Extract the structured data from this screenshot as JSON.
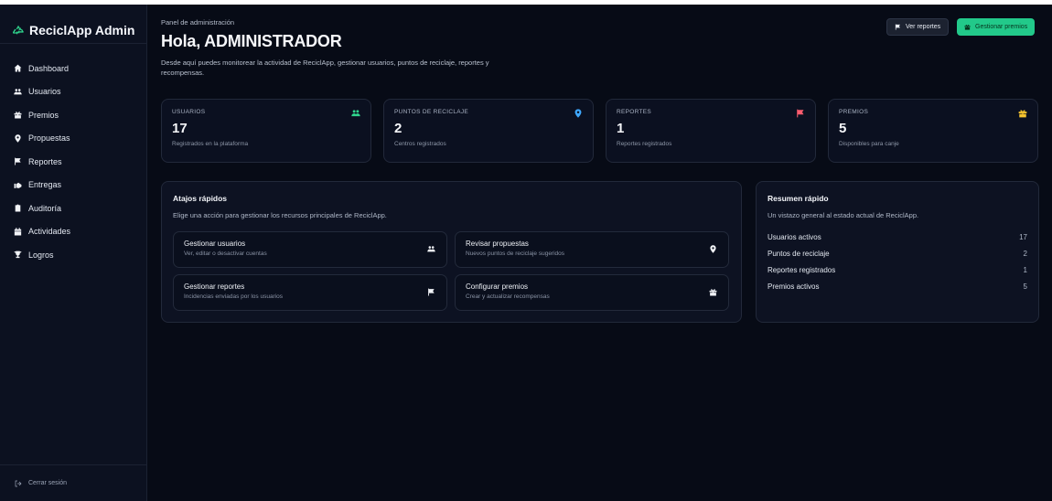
{
  "brand": {
    "name": "ReciclApp Admin",
    "icon": "recycle-icon"
  },
  "nav": [
    {
      "label": "Dashboard",
      "icon": "home-icon"
    },
    {
      "label": "Usuarios",
      "icon": "users-icon"
    },
    {
      "label": "Premios",
      "icon": "gift-icon"
    },
    {
      "label": "Propuestas",
      "icon": "map-pin-icon"
    },
    {
      "label": "Reportes",
      "icon": "flag-icon"
    },
    {
      "label": "Entregas",
      "icon": "handshake-icon"
    },
    {
      "label": "Auditoría",
      "icon": "clipboard-icon"
    },
    {
      "label": "Actividades",
      "icon": "calendar-icon"
    },
    {
      "label": "Logros",
      "icon": "trophy-icon"
    }
  ],
  "logout": {
    "label": "Cerrar sesión",
    "icon": "logout-icon"
  },
  "header": {
    "eyebrow": "Panel de administración",
    "title": "Hola, ADMINISTRADOR",
    "intro": "Desde aquí puedes monitorear la actividad de ReciclApp, gestionar usuarios, puntos de reciclaje, reportes y recompensas.",
    "btn_reports": "Ver reportes",
    "btn_prizes": "Gestionar premios"
  },
  "colors": {
    "accent_green": "#22c98a",
    "users_icon": "#2fd38c",
    "pin_icon": "#3fa8ff",
    "flag_icon": "#ff5c6e",
    "gift_icon": "#f6c32e"
  },
  "stats": [
    {
      "label": "USUARIOS",
      "value": "17",
      "sub": "Registrados en la plataforma",
      "icon": "users-icon"
    },
    {
      "label": "PUNTOS DE RECICLAJE",
      "value": "2",
      "sub": "Centros registrados",
      "icon": "map-pin-icon"
    },
    {
      "label": "REPORTES",
      "value": "1",
      "sub": "Reportes registrados",
      "icon": "flag-icon"
    },
    {
      "label": "PREMIOS",
      "value": "5",
      "sub": "Disponibles para canje",
      "icon": "gift-icon"
    }
  ],
  "shortcuts": {
    "title": "Atajos rápidos",
    "subtitle": "Elige una acción para gestionar los recursos principales de ReciclApp.",
    "items": [
      {
        "title": "Gestionar usuarios",
        "desc": "Ver, editar o desactivar cuentas",
        "icon": "users-icon"
      },
      {
        "title": "Revisar propuestas",
        "desc": "Nuevos puntos de reciclaje sugeridos",
        "icon": "map-pin-icon"
      },
      {
        "title": "Gestionar reportes",
        "desc": "Incidencias enviadas por los usuarios",
        "icon": "flag-icon"
      },
      {
        "title": "Configurar premios",
        "desc": "Crear y actualizar recompensas",
        "icon": "gift-icon"
      }
    ]
  },
  "summary": {
    "title": "Resumen rápido",
    "subtitle": "Un vistazo general al estado actual de ReciclApp.",
    "rows": [
      {
        "label": "Usuarios activos",
        "value": "17"
      },
      {
        "label": "Puntos de reciclaje",
        "value": "2"
      },
      {
        "label": "Reportes registrados",
        "value": "1"
      },
      {
        "label": "Premios activos",
        "value": "5"
      }
    ]
  }
}
